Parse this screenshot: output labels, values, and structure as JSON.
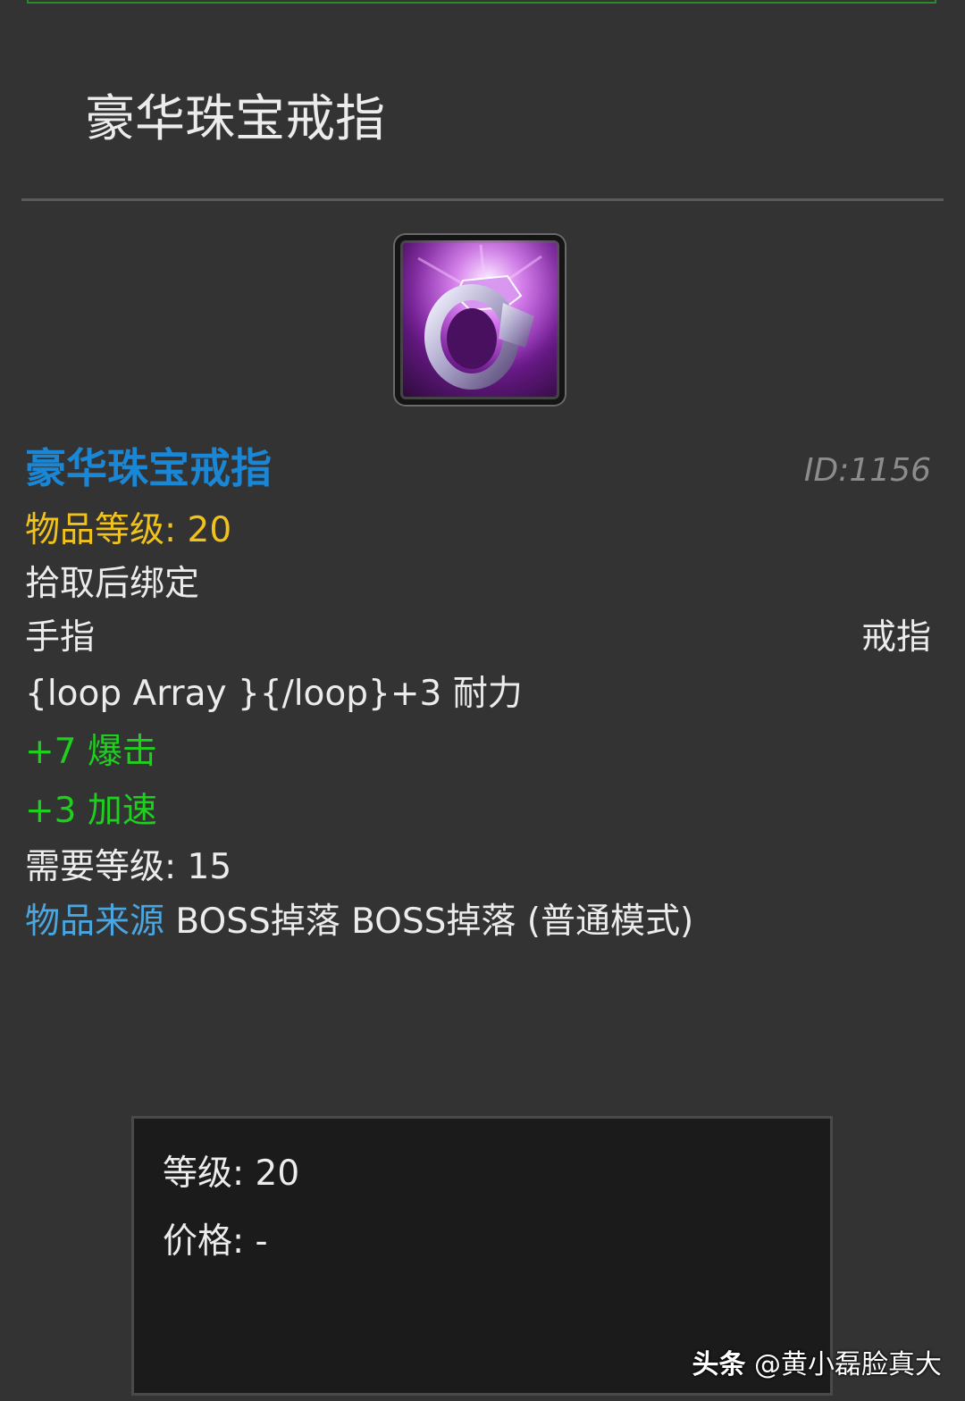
{
  "header": {
    "title": "豪华珠宝戒指"
  },
  "item": {
    "icon": "purple-gem-ring-icon",
    "name": "豪华珠宝戒指",
    "id_text": "ID:1156",
    "item_level": "物品等级: 20",
    "bind": "拾取后绑定",
    "slot": "手指",
    "type": "戒指",
    "stat_stamina": "{loop Array }{/loop}+3 耐力",
    "stat_crit": "+7 爆击",
    "stat_haste": "+3 加速",
    "required_level": "需要等级: 15",
    "source_label": "物品来源",
    "source_value": "BOSS掉落 BOSS掉落 (普通模式)"
  },
  "info_box": {
    "level": "等级: 20",
    "price": "价格: -"
  },
  "watermark": {
    "brand": "头条",
    "author": "@黄小磊脸真大"
  },
  "colors": {
    "background": "#333333",
    "item_name": "#1a86d6",
    "item_level": "#f1c21b",
    "green_stat": "#1ed01e",
    "source_label": "#4aa6e0",
    "id_text": "#8c8c8c"
  }
}
